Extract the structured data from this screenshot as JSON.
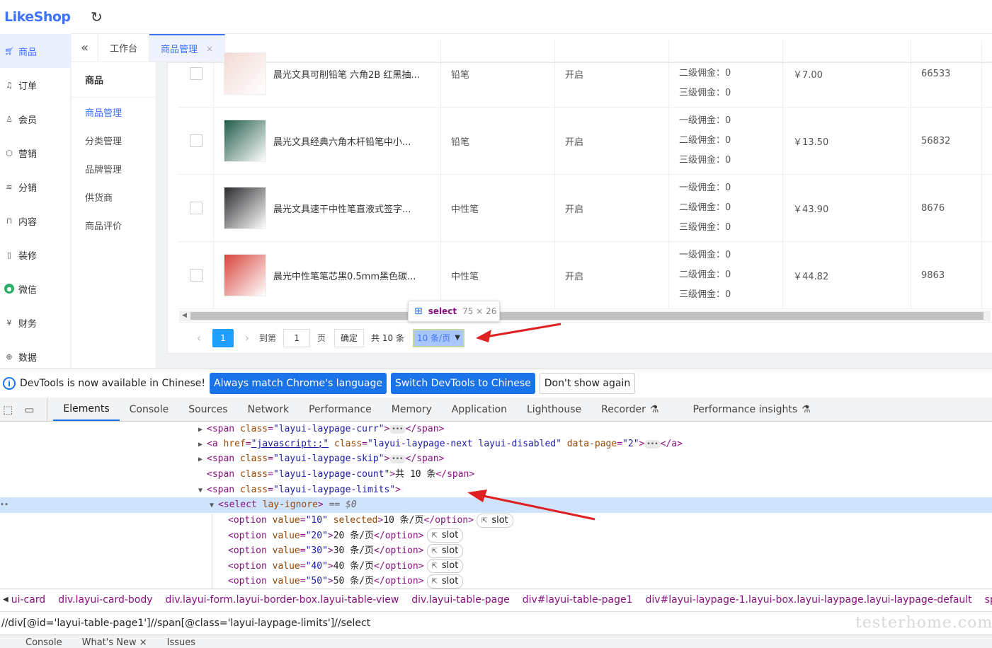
{
  "app": {
    "logo": "LikeShop",
    "sidebar": [
      {
        "label": "商品",
        "icon": "cart-icon",
        "active": true
      },
      {
        "label": "订单",
        "icon": "bell-icon"
      },
      {
        "label": "会员",
        "icon": "user-icon"
      },
      {
        "label": "营销",
        "icon": "box-icon"
      },
      {
        "label": "分销",
        "icon": "layers-icon"
      },
      {
        "label": "内容",
        "icon": "book-icon"
      },
      {
        "label": "装修",
        "icon": "phone-icon"
      },
      {
        "label": "微信",
        "icon": "wechat-icon"
      },
      {
        "label": "财务",
        "icon": "yen-icon"
      },
      {
        "label": "数据",
        "icon": "globe-icon"
      }
    ],
    "subsidebar": {
      "title": "商品",
      "items": [
        "商品管理",
        "分类管理",
        "品牌管理",
        "供货商",
        "商品评价"
      ]
    },
    "tabs": {
      "home": "工作台",
      "current": "商品管理",
      "close": "×"
    },
    "rows": [
      {
        "name": "晨光文具可削铅笔 六角2B 红黑抽...",
        "category": "铅笔",
        "status": "开启",
        "commissions": [
          "二级佣金：0",
          "三级佣金：0"
        ],
        "price": "￥7.00",
        "stock": "66533",
        "thumb_color": "#f3d9d4"
      },
      {
        "name": "晨光文具经典六角木杆铅笔中小...",
        "category": "铅笔",
        "status": "开启",
        "commissions": [
          "一级佣金：0",
          "二级佣金：0",
          "三级佣金：0"
        ],
        "price": "￥13.50",
        "stock": "56832",
        "thumb_color": "#1f5c4a"
      },
      {
        "name": "晨光文具速干中性笔直液式签字...",
        "category": "中性笔",
        "status": "开启",
        "commissions": [
          "一级佣金：0",
          "二级佣金：0",
          "三级佣金：0"
        ],
        "price": "￥43.90",
        "stock": "8676",
        "thumb_color": "#2a2a2e"
      },
      {
        "name": "晨光中性笔笔芯黑0.5mm黑色碳...",
        "category": "中性笔",
        "status": "开启",
        "commissions": [
          "一级佣金：0",
          "二级佣金：0",
          "三级佣金：0"
        ],
        "price": "￥44.82",
        "stock": "9863",
        "thumb_color": "#d8453b"
      }
    ],
    "pager": {
      "prev": "‹",
      "curr": "1",
      "next": "›",
      "goto": "到第",
      "page_input": "1",
      "page_unit": "页",
      "confirm": "确定",
      "count": "共 10 条",
      "limit": "10 条/页"
    },
    "tooltip": {
      "tag": "select",
      "dims": "75 × 26"
    }
  },
  "devtools": {
    "infobar": {
      "message": "DevTools is now available in Chinese!",
      "btn1": "Always match Chrome's language",
      "btn2": "Switch DevTools to Chinese",
      "btn3": "Don't show again"
    },
    "tabs": [
      "Elements",
      "Console",
      "Sources",
      "Network",
      "Performance",
      "Memory",
      "Application",
      "Lighthouse",
      "Recorder",
      "Performance insights"
    ],
    "lines": {
      "l1": "\"layui-laypage-curr\"",
      "l2_href": "\"javascript:;\"",
      "l2_class": "\"layui-laypage-next layui-disabled\"",
      "l2_page": "\"2\"",
      "l3": "\"layui-laypage-skip\"",
      "l4_class": "\"layui-laypage-count\"",
      "l4_text": "共 10 条",
      "l5": "\"layui-laypage-limits\"",
      "l6_attr": "lay-ignore",
      "l6_eq": "== $0",
      "options": [
        {
          "value": "\"10\"",
          "selected": "selected",
          "text": "10 条/页"
        },
        {
          "value": "\"20\"",
          "text": "20 条/页"
        },
        {
          "value": "\"30\"",
          "text": "30 条/页"
        },
        {
          "value": "\"40\"",
          "text": "40 条/页"
        },
        {
          "value": "\"50\"",
          "text": "50 条/页"
        }
      ],
      "slot": "slot"
    },
    "breadcrumbs": [
      "ui-card",
      "div.layui-card-body",
      "div.layui-form.layui-border-box.layui-table-view",
      "div.layui-table-page",
      "div#layui-table-page1",
      "div#layui-laypage-1.layui-box.layui-laypage.layui-laypage-default",
      "span.layui-l"
    ],
    "xpath": "//div[@id='layui-table-page1']//span[@class='layui-laypage-limits']//select",
    "drawer": [
      "Console",
      "What's New ×",
      "Issues"
    ]
  },
  "watermark": "testerhome.com"
}
